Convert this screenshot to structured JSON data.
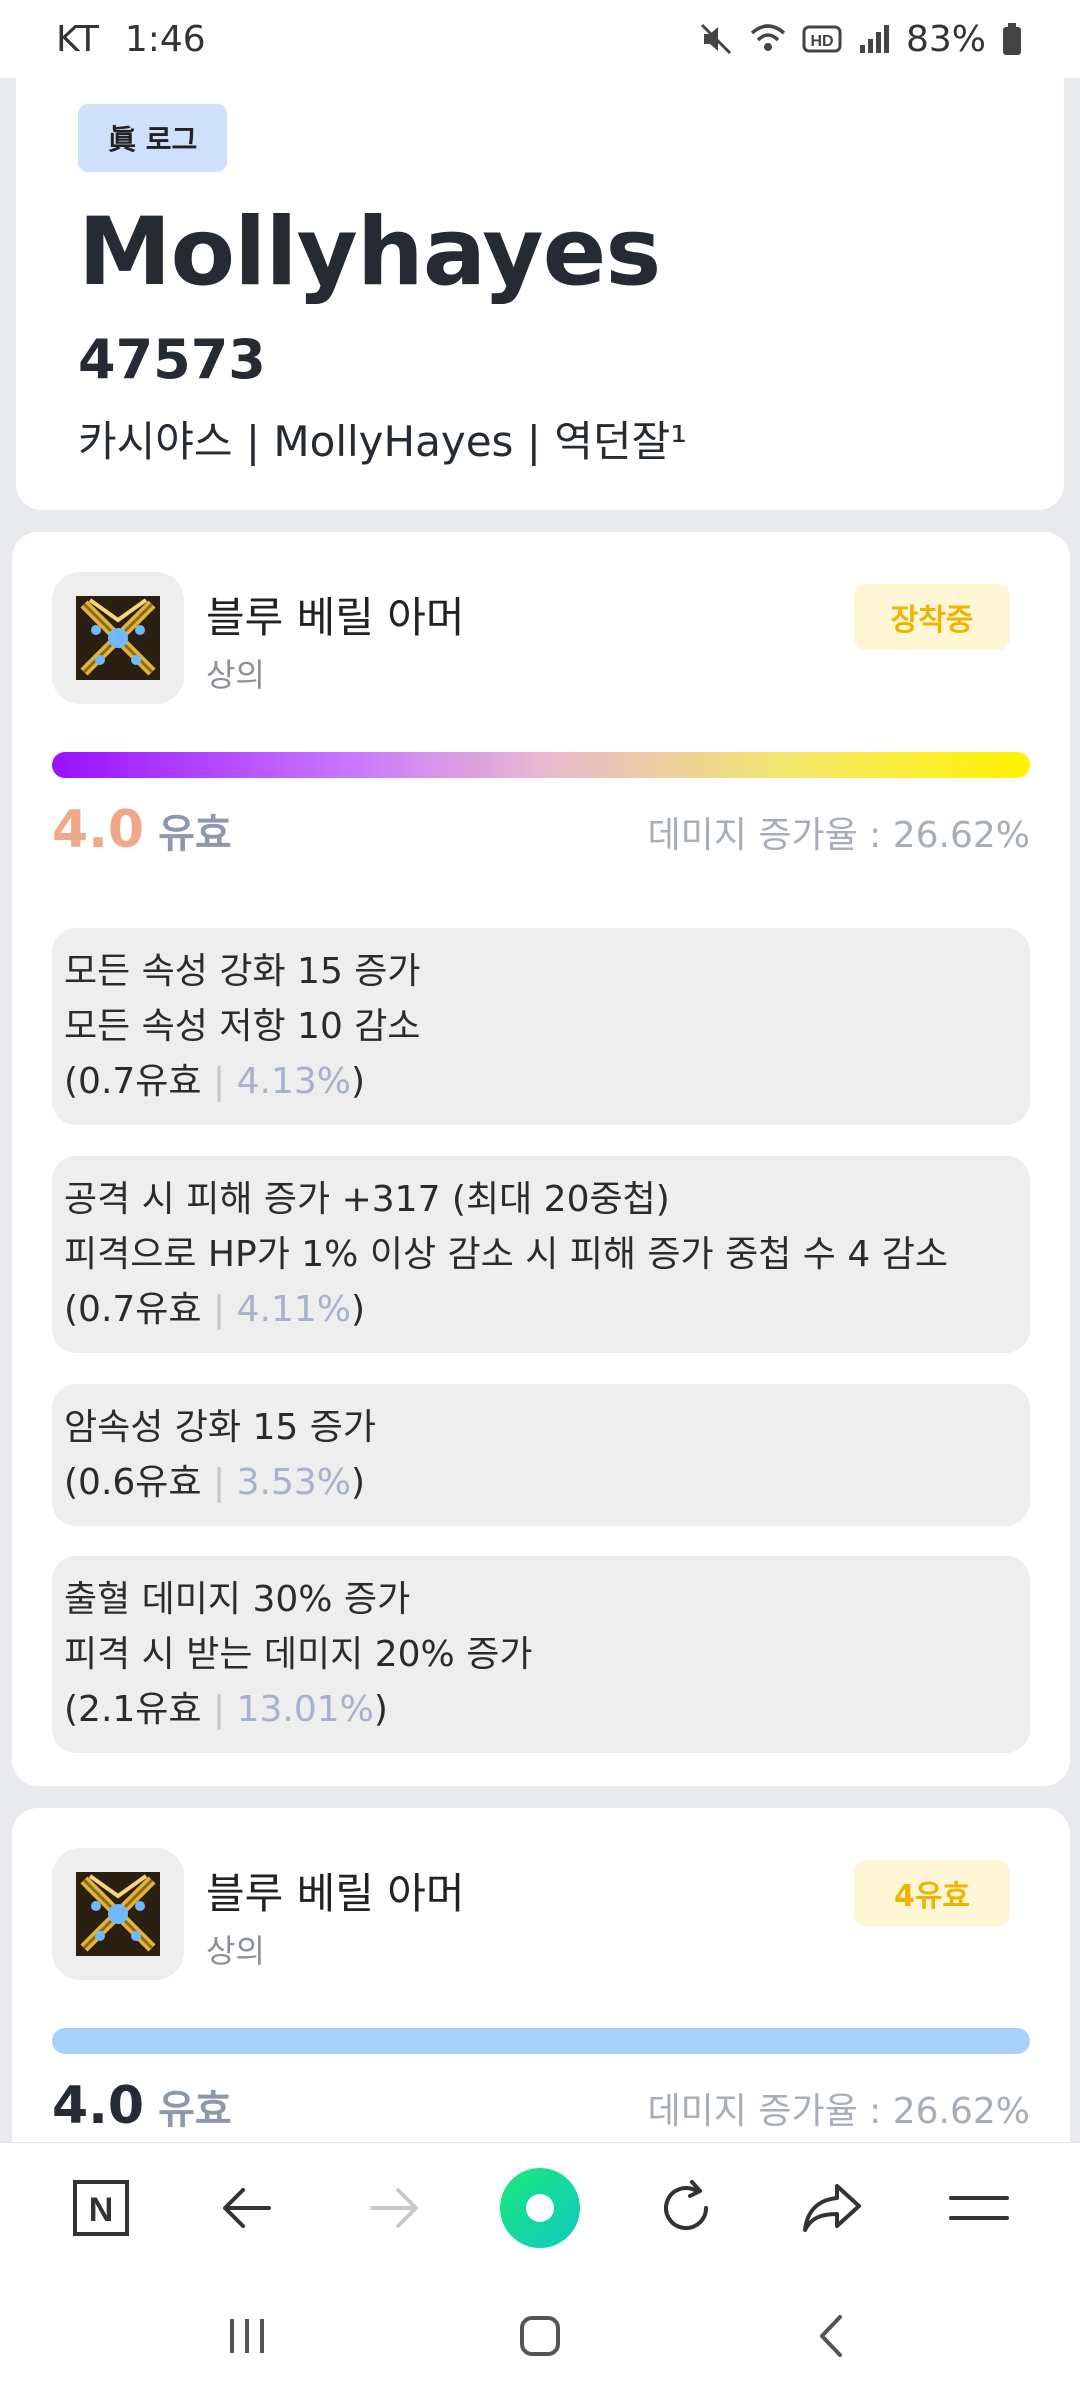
{
  "status_bar": {
    "carrier": "KT",
    "time": "1:46",
    "hd_label": "HD",
    "battery": "83%"
  },
  "profile": {
    "tag": "眞 로그",
    "name": "Mollyhayes",
    "number": "47573",
    "info": "카시야스 | MollyHayes | 역던잘¹"
  },
  "items": [
    {
      "title": "블루 베릴 아머",
      "slot": "상의",
      "status": "장착중",
      "score": "4.0",
      "score_unit": "유효",
      "damage_rate": "데미지 증가율 : 26.62%",
      "options": [
        {
          "lines": [
            "모든 속성 강화 15 증가",
            "모든 속성 저항 10 감소"
          ],
          "foot_value": "(0.7유효",
          "foot_pct": "4.13%",
          "foot_close": ")"
        },
        {
          "lines": [
            "공격 시 피해 증가 +317 (최대 20중첩)",
            "피격으로 HP가 1% 이상 감소 시 피해 증가 중첩 수 4 감소"
          ],
          "foot_value": "(0.7유효",
          "foot_pct": "4.11%",
          "foot_close": ")"
        },
        {
          "lines": [
            "암속성 강화 15 증가"
          ],
          "foot_value": "(0.6유효",
          "foot_pct": "3.53%",
          "foot_close": ")"
        },
        {
          "lines": [
            "출혈 데미지 30% 증가",
            "피격 시 받는 데미지 20% 증가"
          ],
          "foot_value": "(2.1유효",
          "foot_pct": "13.01%",
          "foot_close": ")"
        }
      ]
    },
    {
      "title": "블루 베릴 아머",
      "slot": "상의",
      "status": "4유효",
      "score": "4.0",
      "score_unit": "유효",
      "damage_rate": "데미지 증가율 : 26.62%"
    }
  ],
  "browser_bar": {
    "home_label": "N"
  },
  "colors": {
    "accent_badge": "#cfe0fb",
    "status_pill_bg": "#fff6d6",
    "status_pill_text": "#f0b400",
    "bar_blue": "#a9d0fb"
  }
}
